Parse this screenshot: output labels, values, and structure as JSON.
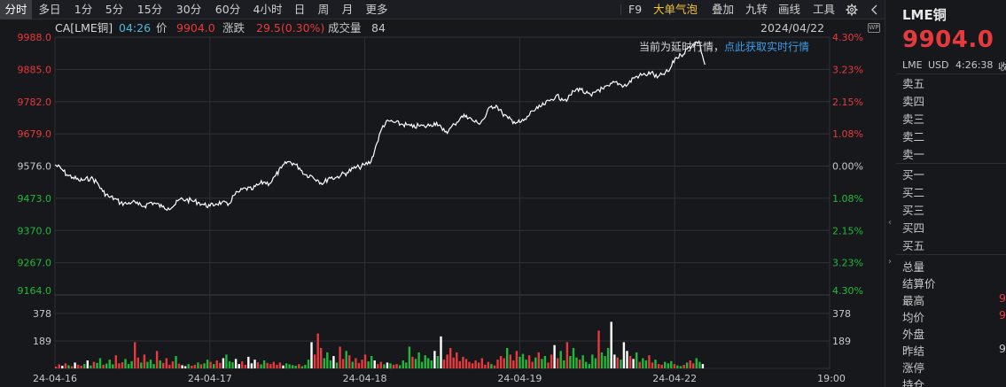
{
  "toolbar": {
    "periods": [
      "分时",
      "多日",
      "1分",
      "5分",
      "15分",
      "30分",
      "60分",
      "4小时",
      "日",
      "周",
      "月",
      "更多"
    ],
    "active_period": "分时",
    "tools": [
      "F9",
      "大单气泡",
      "叠加",
      "九转",
      "画线",
      "工具"
    ],
    "highlight_tool": "大单气泡",
    "settings_icon": "gear-icon",
    "collapse_icon": "chevron-left-icon"
  },
  "info": {
    "symbol": "CA[LME铜]",
    "time": "04:26",
    "price_label": "价",
    "price": "9904.0",
    "change_label": "涨跌",
    "change": "29.5(0.30%)",
    "volume_label": "成交量",
    "volume": "84",
    "date": "2024/04/22",
    "badge": "WP"
  },
  "notice": {
    "delayed": "当前为延时行情，",
    "link": "点此获取实时行情"
  },
  "colors": {
    "up": "#e8393c",
    "down": "#20b83a",
    "line": "#ffffff",
    "grid": "#2e3036",
    "accent": "#f0c23c",
    "link": "#3b9ce6"
  },
  "chart_data": {
    "type": "line",
    "title": "",
    "y_ticks_left": [
      "9988.0",
      "9885.0",
      "9782.0",
      "9679.0",
      "9576.0",
      "9473.0",
      "9370.0",
      "9267.0",
      "9164.0"
    ],
    "y_ticks_right": [
      "4.30%",
      "3.23%",
      "2.15%",
      "1.08%",
      "0.00%",
      "1.08%",
      "2.15%",
      "3.23%",
      "4.30%"
    ],
    "ylim": [
      9164.0,
      9988.0
    ],
    "base_price": 9576.0,
    "x_ticks": [
      "24-04-16",
      "24-04-17",
      "24-04-18",
      "24-04-19",
      "24-04-22",
      "19:00"
    ],
    "x_sessions": 5,
    "series": [
      {
        "values": [
          9580,
          9568,
          9548,
          9540,
          9530,
          9532,
          9538,
          9525,
          9495,
          9478,
          9472,
          9458,
          9455,
          9462,
          9452,
          9448,
          9460,
          9455,
          9445,
          9442,
          9450,
          9470,
          9468,
          9465,
          9460,
          9452,
          9448,
          9455,
          9460,
          9450,
          9482,
          9495,
          9505,
          9500,
          9515,
          9525,
          9520,
          9545,
          9570,
          9590,
          9585,
          9570,
          9548,
          9545,
          9532,
          9520,
          9540,
          9538,
          9548,
          9555,
          9568,
          9572,
          9580,
          9590,
          9650,
          9705,
          9720,
          9715,
          9710,
          9708,
          9700,
          9705,
          9702,
          9708,
          9715,
          9690,
          9688,
          9710,
          9730,
          9738,
          9722,
          9712,
          9728,
          9765,
          9770,
          9745,
          9728,
          9718,
          9715,
          9725,
          9752,
          9760,
          9772,
          9785,
          9800,
          9792,
          9790,
          9815,
          9825,
          9808,
          9800,
          9820,
          9822,
          9832,
          9845,
          9835,
          9835,
          9858,
          9865,
          9868,
          9875,
          9858,
          9870,
          9880,
          9920,
          9930,
          9950,
          9965,
          9975,
          9900
        ]
      }
    ],
    "volume": {
      "y_ticks": [
        "378",
        "189"
      ],
      "ylim": [
        0,
        420
      ],
      "bars": [
        12,
        28,
        18,
        35,
        22,
        15,
        40,
        25,
        19,
        30,
        55,
        20,
        45,
        38,
        70,
        25,
        33,
        60,
        28,
        90,
        35,
        42,
        65,
        30,
        50,
        180,
        75,
        40,
        95,
        45,
        60,
        30,
        120,
        55,
        38,
        70,
        25,
        48,
        85,
        32,
        22,
        15,
        30,
        18,
        25,
        40,
        28,
        35,
        60,
        45,
        30,
        55,
        38,
        70,
        95,
        50,
        42,
        65,
        30,
        48,
        25,
        80,
        35,
        60,
        42,
        28,
        55,
        38,
        30,
        45,
        25,
        40,
        20,
        35,
        28,
        22,
        18,
        30,
        15,
        25,
        60,
        180,
        95,
        240,
        140,
        70,
        110,
        55,
        85,
        40,
        150,
        65,
        120,
        90,
        45,
        70,
        38,
        60,
        95,
        48,
        85,
        55,
        30,
        45,
        28,
        40,
        35,
        25,
        30,
        22,
        55,
        40,
        150,
        80,
        65,
        110,
        45,
        90,
        70,
        55,
        120,
        85,
        220,
        60,
        95,
        140,
        75,
        110,
        50,
        80,
        65,
        45,
        35,
        55,
        40,
        70,
        25,
        45,
        30,
        20,
        60,
        85,
        70,
        140,
        95,
        55,
        120,
        80,
        100,
        60,
        90,
        45,
        75,
        110,
        65,
        85,
        40,
        95,
        160,
        70,
        120,
        55,
        180,
        85,
        140,
        75,
        60,
        90,
        45,
        30,
        95,
        70,
        260,
        110,
        85,
        140,
        320,
        95,
        75,
        60,
        180,
        120,
        85,
        65,
        110,
        45,
        70,
        55,
        90,
        40,
        60,
        30,
        25,
        45,
        35,
        50,
        30,
        20,
        15,
        25,
        40,
        55,
        35,
        70,
        45,
        30
      ]
    }
  },
  "panel": {
    "title": "LME铜",
    "price": "9904.0",
    "market": "LME",
    "currency": "USD",
    "time": "4:26:38",
    "flag": "收",
    "asks": [
      "卖五",
      "卖四",
      "卖三",
      "卖二",
      "卖一"
    ],
    "bids": [
      "买一",
      "买二",
      "买三",
      "买四",
      "买五"
    ],
    "stats": [
      {
        "label": "总量",
        "value": ""
      },
      {
        "label": "结算价",
        "value": ""
      },
      {
        "label": "最高",
        "value": "9"
      },
      {
        "label": "均价",
        "value": "9"
      },
      {
        "label": "外盘",
        "value": ""
      },
      {
        "label": "昨结",
        "value": "9"
      },
      {
        "label": "涨停",
        "value": ""
      },
      {
        "label": "持仓",
        "value": ""
      }
    ]
  }
}
